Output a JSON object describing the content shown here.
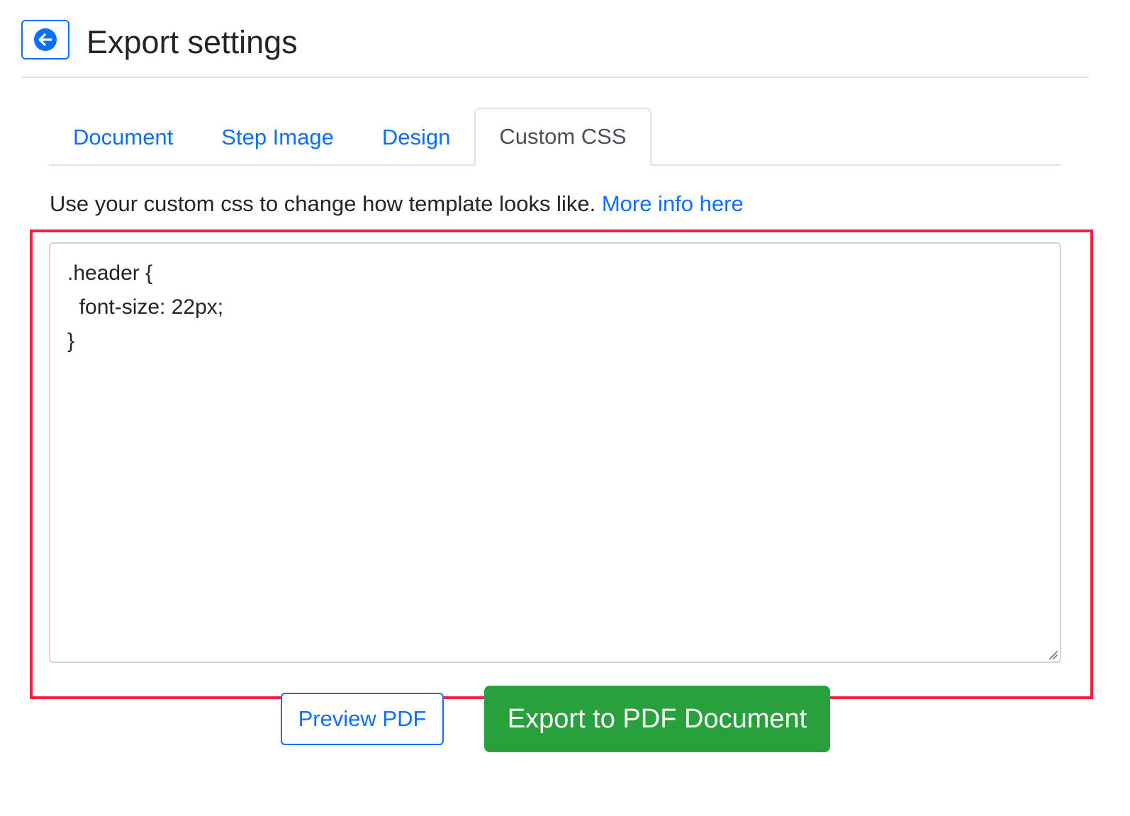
{
  "header": {
    "title": "Export settings",
    "back_icon": "arrow-left-circle-icon"
  },
  "tabs": [
    {
      "label": "Document",
      "active": false
    },
    {
      "label": "Step Image",
      "active": false
    },
    {
      "label": "Design",
      "active": false
    },
    {
      "label": "Custom CSS",
      "active": true
    }
  ],
  "custom_css": {
    "description": "Use your custom css to change how template looks like.",
    "link_label": "More info here",
    "editor_value": ".header {\n  font-size: 22px;\n}"
  },
  "actions": {
    "preview_label": "Preview PDF",
    "export_label": "Export to PDF Document"
  },
  "colors": {
    "primary": "#0d6efd",
    "success": "#28a03c",
    "highlight": "#f0233f"
  }
}
